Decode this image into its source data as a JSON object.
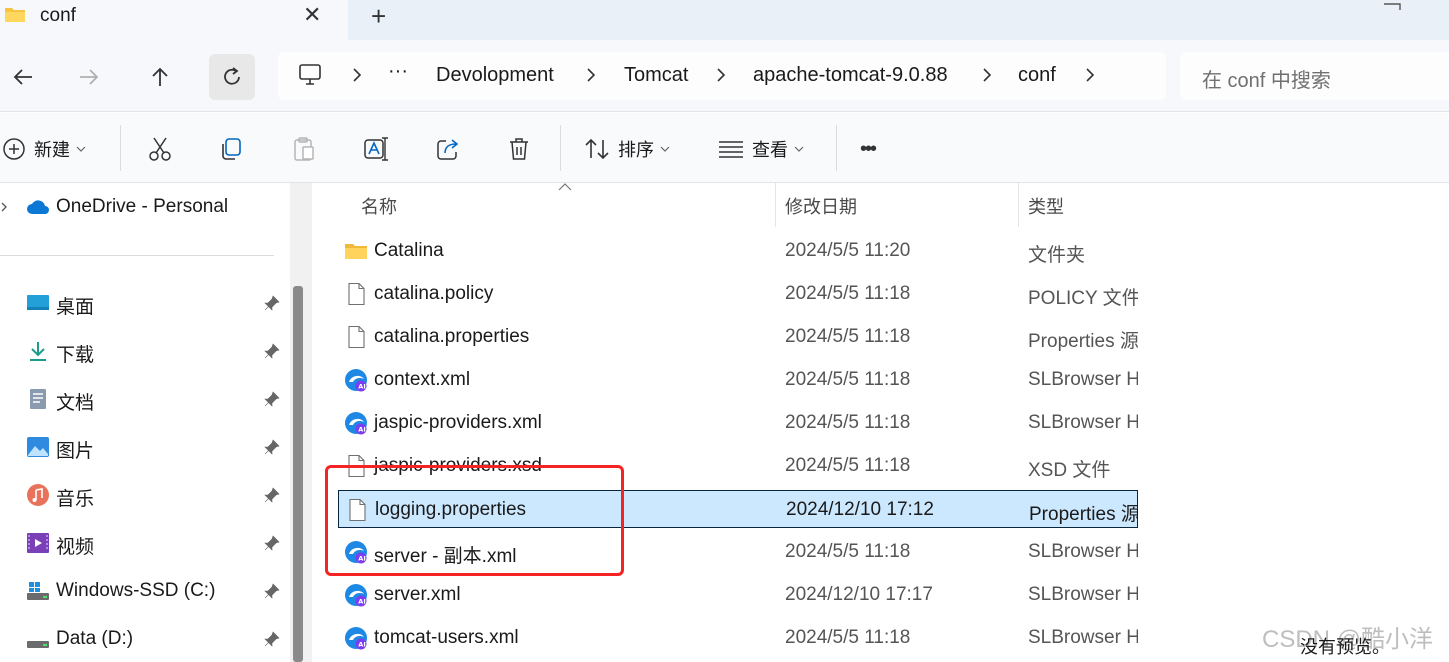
{
  "tab": {
    "title": "conf",
    "close_glyph": "✕",
    "new_glyph": "+"
  },
  "address": {
    "overflow": "···",
    "crumbs": [
      "Devolopment",
      "Tomcat",
      "apache-tomcat-9.0.88",
      "conf"
    ]
  },
  "search": {
    "placeholder": "在 conf 中搜索"
  },
  "commands": {
    "new_label": "新建",
    "sort_label": "排序",
    "view_label": "查看",
    "more_glyph": "•••"
  },
  "sidebar": {
    "onedrive": "OneDrive - Personal",
    "items": [
      {
        "label": "桌面"
      },
      {
        "label": "下载"
      },
      {
        "label": "文档"
      },
      {
        "label": "图片"
      },
      {
        "label": "音乐"
      },
      {
        "label": "视频"
      },
      {
        "label": "Windows-SSD (C:)"
      },
      {
        "label": "Data (D:)"
      }
    ]
  },
  "columns": {
    "name": "名称",
    "date": "修改日期",
    "type": "类型"
  },
  "files": [
    {
      "name": "Catalina",
      "date": "2024/5/5 11:20",
      "type": "文件夹",
      "icon": "folder"
    },
    {
      "name": "catalina.policy",
      "date": "2024/5/5 11:18",
      "type": "POLICY 文件",
      "icon": "file"
    },
    {
      "name": "catalina.properties",
      "date": "2024/5/5 11:18",
      "type": "Properties 源",
      "icon": "file"
    },
    {
      "name": "context.xml",
      "date": "2024/5/5 11:18",
      "type": "SLBrowser HT",
      "icon": "browser"
    },
    {
      "name": "jaspic-providers.xml",
      "date": "2024/5/5 11:18",
      "type": "SLBrowser HT",
      "icon": "browser"
    },
    {
      "name": "jaspic-providers.xsd",
      "date": "2024/5/5 11:18",
      "type": "XSD 文件",
      "icon": "file"
    },
    {
      "name": "logging.properties",
      "date": "2024/12/10 17:12",
      "type": "Properties 源",
      "icon": "file"
    },
    {
      "name": "server - 副本.xml",
      "date": "2024/5/5 11:18",
      "type": "SLBrowser HT",
      "icon": "browser"
    },
    {
      "name": "server.xml",
      "date": "2024/12/10 17:17",
      "type": "SLBrowser HT",
      "icon": "browser"
    },
    {
      "name": "tomcat-users.xml",
      "date": "2024/5/5 11:18",
      "type": "SLBrowser HT",
      "icon": "browser"
    }
  ],
  "preview": {
    "empty_text": "没有预览。"
  },
  "watermark": "CSDN @酷小洋",
  "colors": {
    "selection": "#cce8ff",
    "annotation": "#f52323",
    "accent": "#0067c0"
  }
}
